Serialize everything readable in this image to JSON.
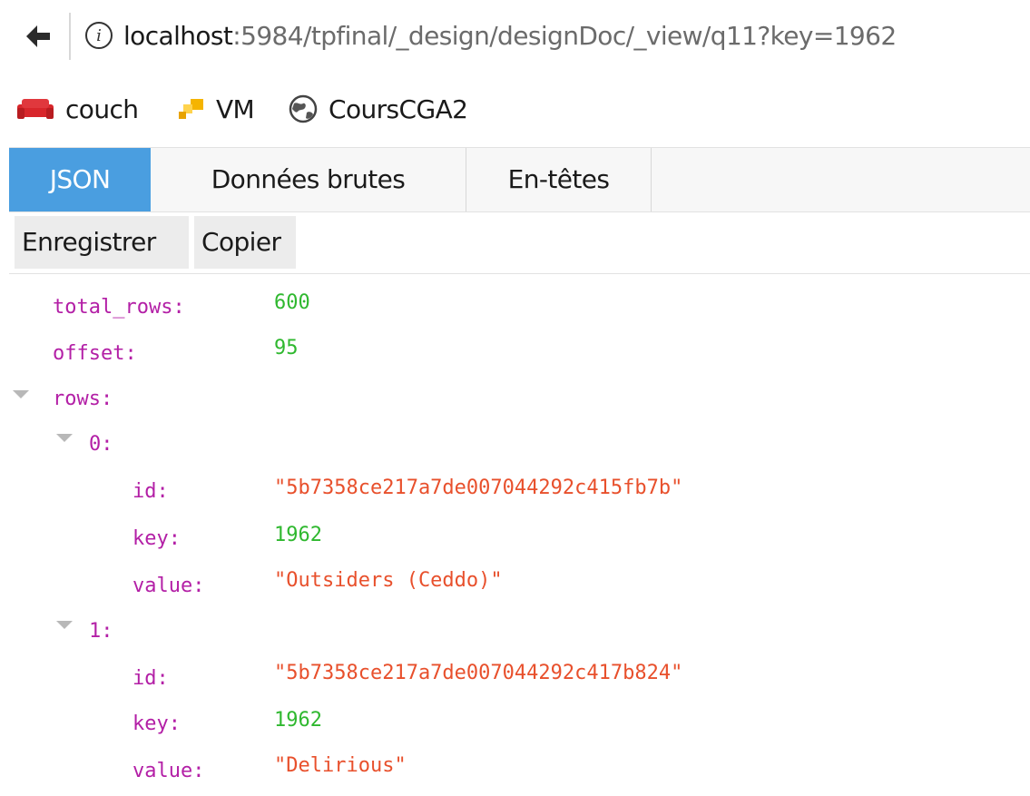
{
  "browser": {
    "url_host": "localhost",
    "url_rest": ":5984/tpfinal/_design/designDoc/_view/q11?key=1962"
  },
  "bookmarks": [
    {
      "label": "couch",
      "icon": "couch-icon"
    },
    {
      "label": "VM",
      "icon": "vm-icon"
    },
    {
      "label": "CoursCGA2",
      "icon": "globe-icon"
    }
  ],
  "tabs": {
    "json": "JSON",
    "raw": "Données brutes",
    "headers": "En-têtes"
  },
  "toolbar": {
    "save": "Enregistrer",
    "copy": "Copier"
  },
  "json": {
    "total_rows_key": "total_rows:",
    "total_rows": "600",
    "offset_key": "offset:",
    "offset": "95",
    "rows_key": "rows:",
    "rows": [
      {
        "index": "0:",
        "id_key": "id:",
        "id": "\"5b7358ce217a7de007044292c415fb7b\"",
        "key_key": "key:",
        "key": "1962",
        "value_key": "value:",
        "value": "\"Outsiders (Ceddo)\""
      },
      {
        "index": "1:",
        "id_key": "id:",
        "id": "\"5b7358ce217a7de007044292c417b824\"",
        "key_key": "key:",
        "key": "1962",
        "value_key": "value:",
        "value": "\"Delirious\""
      }
    ]
  },
  "colors": {
    "key": "#b31fa6",
    "number": "#2fb82f",
    "string": "#e8502c",
    "active_tab": "#4a9ee0"
  }
}
